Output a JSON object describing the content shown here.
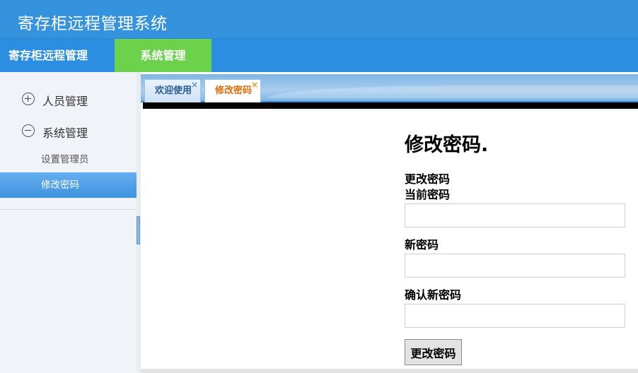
{
  "app": {
    "title": "寄存柜远程管理系统"
  },
  "nav": {
    "tabs": [
      {
        "label": "寄存柜远程管理"
      },
      {
        "label": "系统管理"
      }
    ]
  },
  "sidebar": {
    "groups": [
      {
        "label": "人员管理",
        "icon": "plus-circle-icon"
      },
      {
        "label": "系统管理",
        "icon": "minus-circle-icon"
      }
    ],
    "sub_items": [
      {
        "label": "设置管理员"
      },
      {
        "label": "修改密码"
      }
    ]
  },
  "content_tabs": [
    {
      "label": "欢迎使用",
      "close": "×"
    },
    {
      "label": "修改密码",
      "close": "×"
    }
  ],
  "form": {
    "title": "修改密码.",
    "subheading": "更改密码",
    "fields": [
      {
        "label": "当前密码",
        "value": ""
      },
      {
        "label": "新密码",
        "value": ""
      },
      {
        "label": "确认新密码",
        "value": ""
      }
    ],
    "submit_label": "更改密码"
  },
  "colors": {
    "header": "#3592dc",
    "nav": "#2b8ee0",
    "active_nav": "#6cd24c",
    "active_sidebar": "#4b9be6",
    "tab_active_text": "#e36c0a"
  }
}
